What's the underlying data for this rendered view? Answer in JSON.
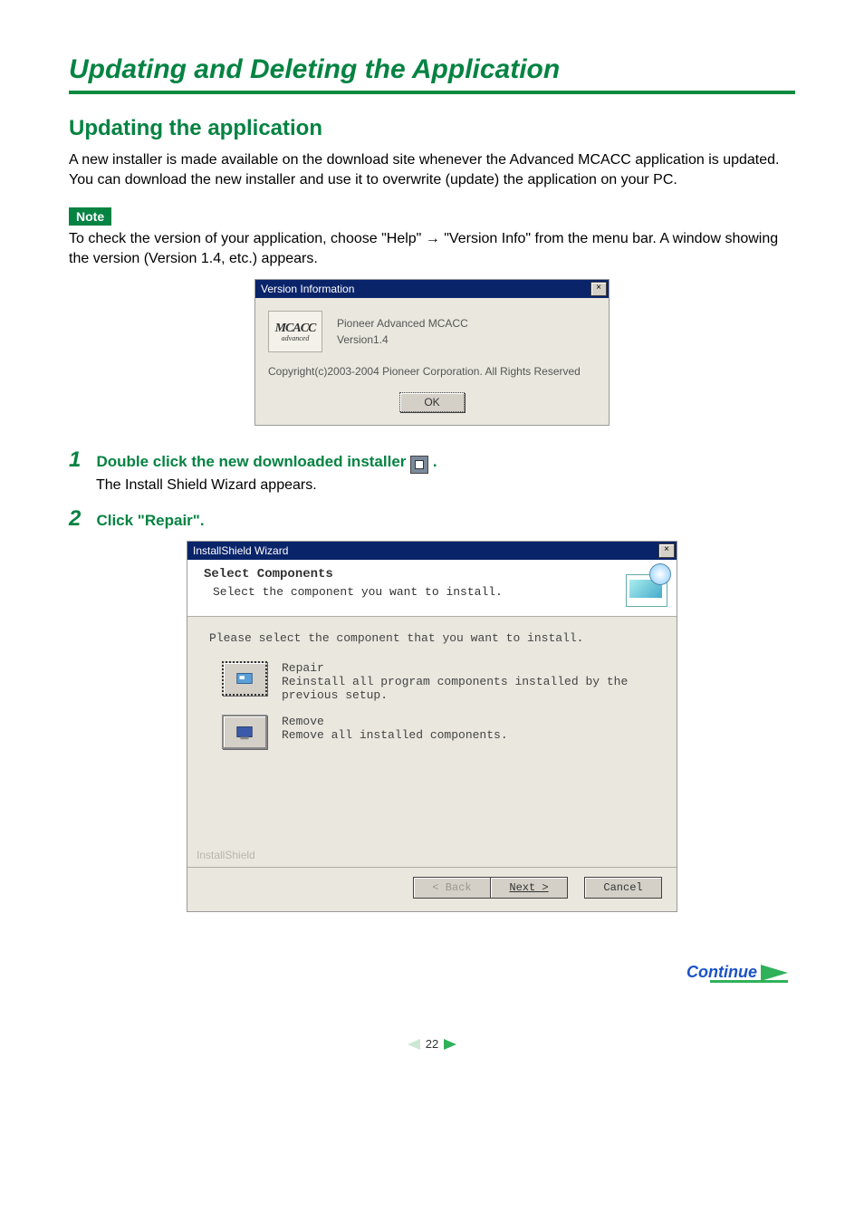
{
  "title": "Updating and Deleting the Application",
  "section": {
    "heading": "Updating the application",
    "body": "A new installer is made available on the download site whenever the Advanced MCACC application is updated. You can download the new installer and use it to overwrite (update) the application on your PC."
  },
  "note": {
    "label": "Note",
    "text_before_arrow": "To check the version of your application, choose \"Help\" ",
    "text_after_arrow": " \"Version Info\" from the menu bar. A window showing the version (Version 1.4, etc.) appears."
  },
  "version_dialog": {
    "title": "Version Information",
    "logo_main": "MCACC",
    "logo_sub": "advanced",
    "line1": "Pioneer Advanced MCACC",
    "line2": "Version1.4",
    "copyright": "Copyright(c)2003-2004 Pioneer Corporation. All Rights Reserved",
    "ok": "OK"
  },
  "steps": {
    "s1_num": "1",
    "s1_title_a": "Double click the new downloaded installer ",
    "s1_title_b": ".",
    "s1_body": "The Install Shield Wizard appears.",
    "s2_num": "2",
    "s2_title": "Click \"Repair\"."
  },
  "wizard": {
    "title": "InstallShield Wizard",
    "h_title": "Select Components",
    "h_sub": "Select the component you want to install.",
    "instruction": "Please select the component that you want to install.",
    "opt1_title": "Repair",
    "opt1_desc": "Reinstall all program components installed by the previous setup.",
    "opt2_title": "Remove",
    "opt2_desc": "Remove all installed components.",
    "brand": "InstallShield",
    "back": "< Back",
    "next": "Next >",
    "cancel": "Cancel"
  },
  "continue_label": "Continue",
  "page_number": "22"
}
